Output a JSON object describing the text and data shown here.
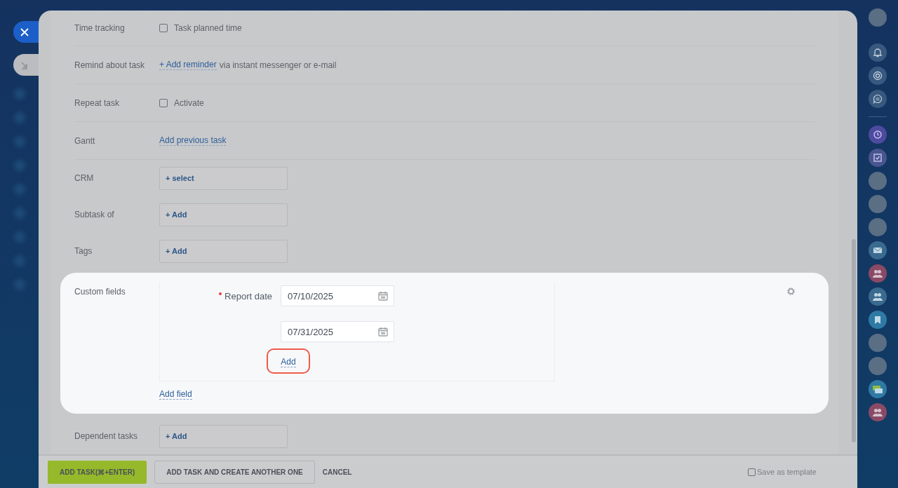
{
  "rows": [
    {
      "kind": "checkbox",
      "label": "Time tracking",
      "text": "Task planned time",
      "checked": false
    },
    {
      "kind": "reminder",
      "label": "Remind about task",
      "link": "+ Add reminder",
      "text": "via instant messenger or e-mail"
    },
    {
      "kind": "checkbox",
      "label": "Repeat task",
      "text": "Activate",
      "checked": false
    },
    {
      "kind": "link",
      "label": "Gantt",
      "link": "Add previous task"
    },
    {
      "kind": "selector",
      "label": "CRM",
      "button": "+ select"
    },
    {
      "kind": "selector",
      "label": "Subtask of",
      "button": "+ Add"
    },
    {
      "kind": "selector",
      "label": "Tags",
      "button": "+ Add"
    }
  ],
  "custom_fields": {
    "label": "Custom fields",
    "fields": [
      {
        "label": "Report date",
        "required": true,
        "values": [
          "07/10/2025",
          "07/31/2025"
        ]
      }
    ],
    "add_link": "Add",
    "add_highlighted": true,
    "add_field_link": "Add field"
  },
  "after_rows": [
    {
      "kind": "selector",
      "label": "Dependent tasks",
      "button": "+ Add"
    }
  ],
  "footer": {
    "buttons": [
      {
        "kind": "primary",
        "label": "ADD TASK(⌘+ENTER)"
      },
      {
        "kind": "secondary",
        "label": "ADD TASK AND CREATE ANOTHER ONE"
      },
      {
        "kind": "plain",
        "label": "CANCEL"
      }
    ],
    "save_template": {
      "label": "Save as template",
      "checked": false
    }
  }
}
